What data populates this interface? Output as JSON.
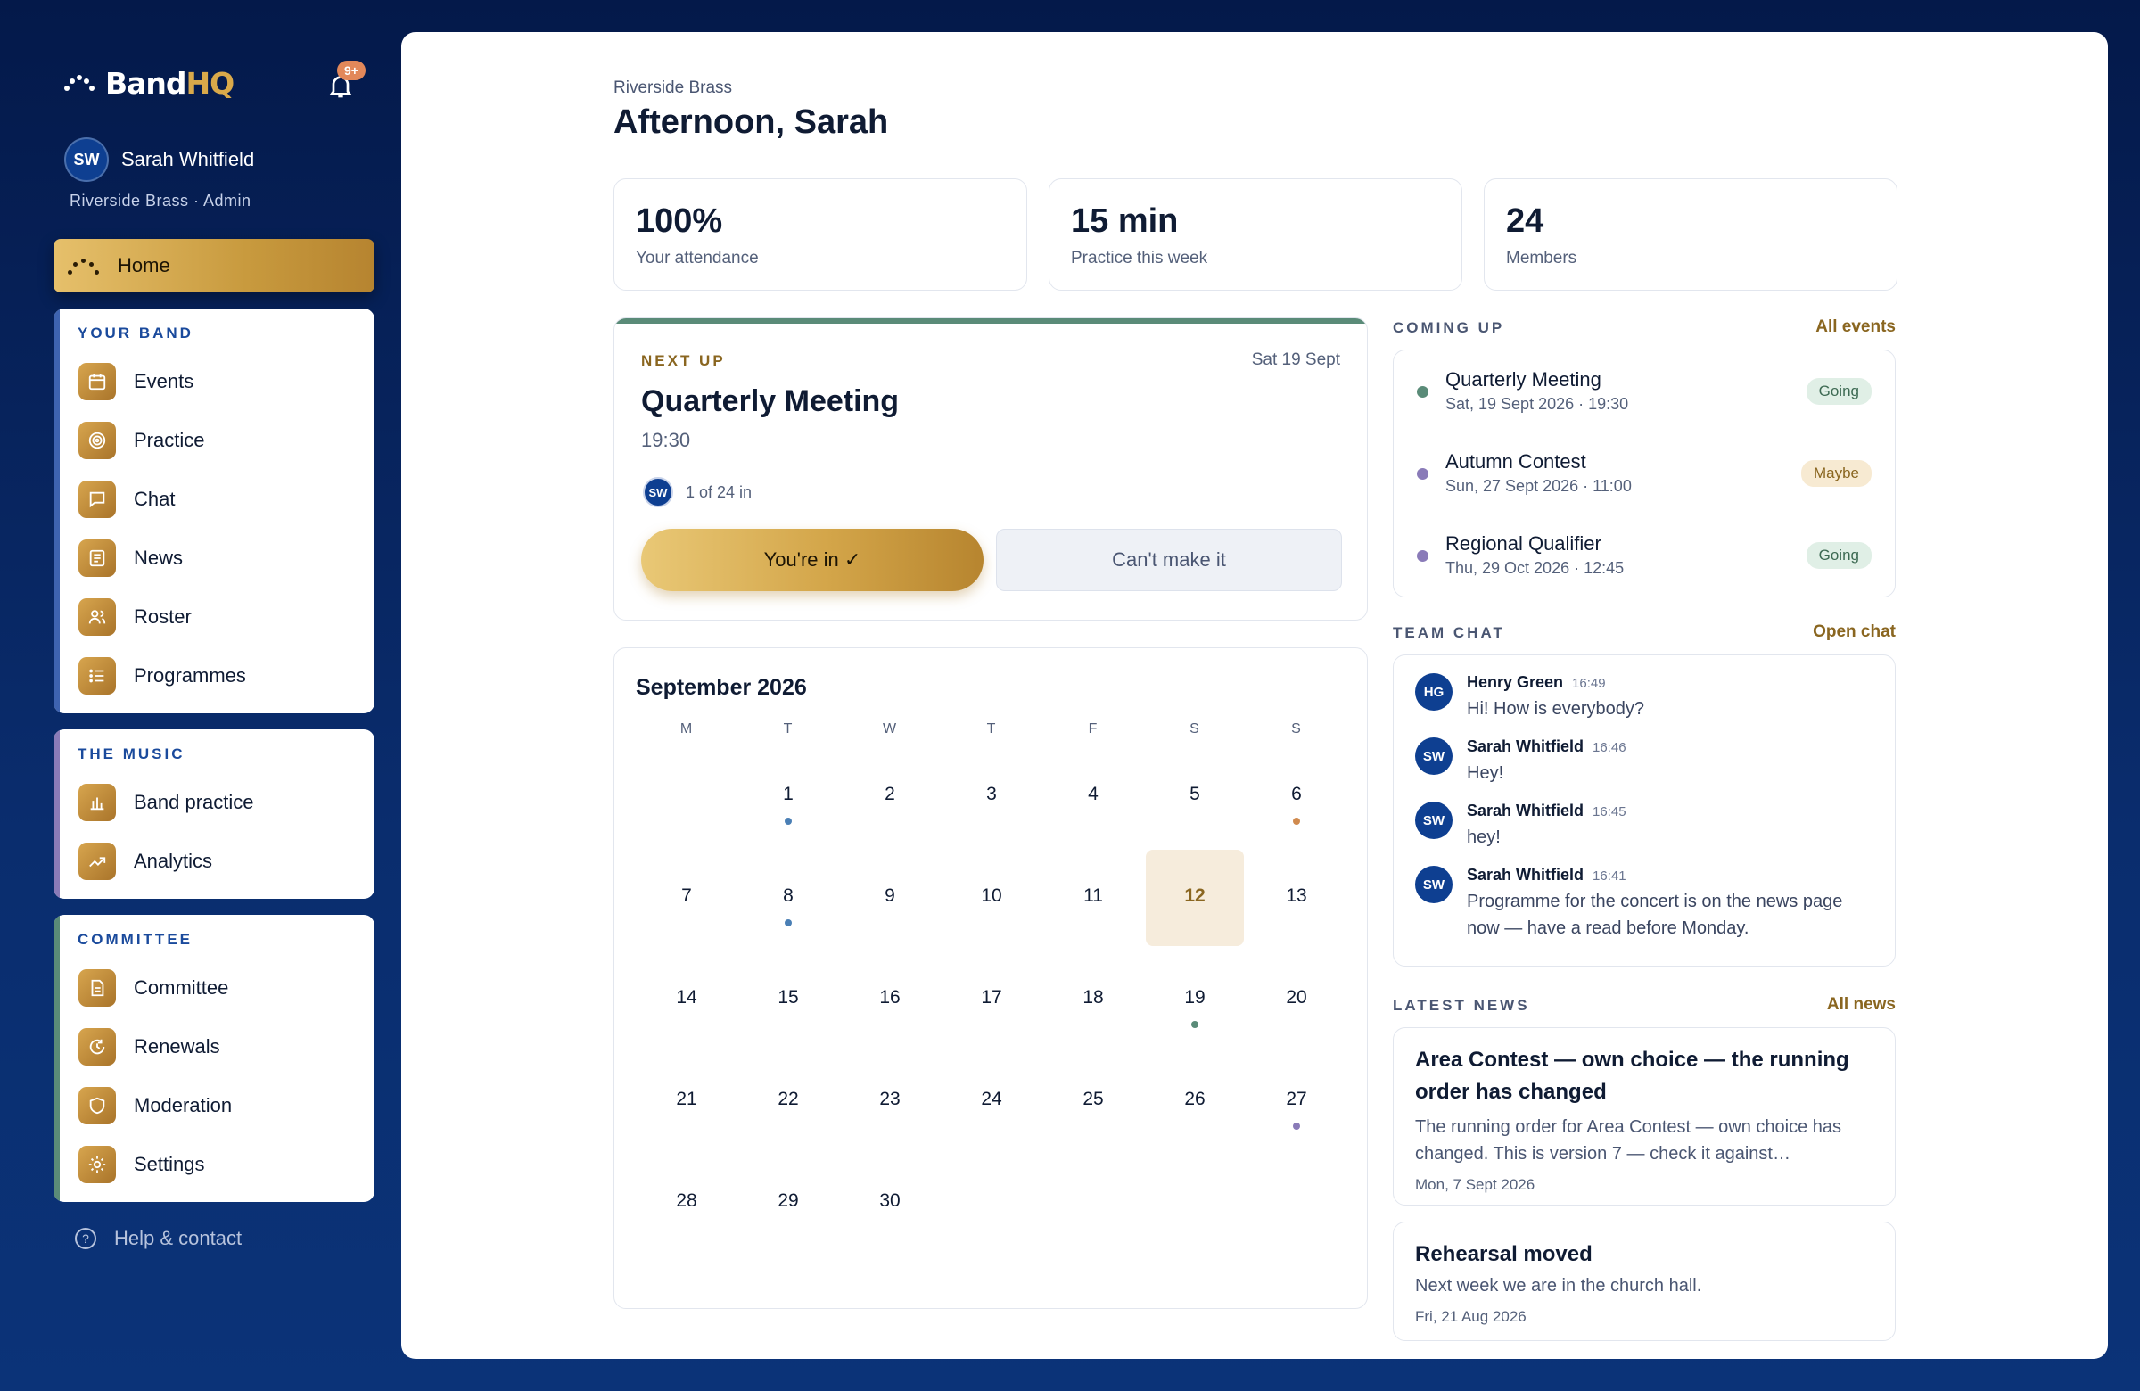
{
  "brand": {
    "name_part1": "Band",
    "name_part2": "HQ"
  },
  "notifications": {
    "badge": "9+"
  },
  "user": {
    "initials": "SW",
    "name": "Sarah Whitfield",
    "role": "Riverside Brass · Admin"
  },
  "nav": {
    "home": "Home",
    "groups": [
      {
        "title": "YOUR BAND",
        "items": [
          "Events",
          "Practice",
          "Chat",
          "News",
          "Roster",
          "Programmes"
        ]
      },
      {
        "title": "THE MUSIC",
        "items": [
          "Band practice",
          "Analytics"
        ]
      },
      {
        "title": "COMMITTEE",
        "items": [
          "Committee",
          "Renewals",
          "Moderation",
          "Settings"
        ]
      }
    ],
    "help": "Help & contact"
  },
  "header": {
    "breadcrumb": "Riverside Brass",
    "title": "Afternoon, Sarah"
  },
  "stats": [
    {
      "value": "100%",
      "label": "Your attendance"
    },
    {
      "value": "15 min",
      "label": "Practice this week"
    },
    {
      "value": "24",
      "label": "Members"
    }
  ],
  "next_up": {
    "kicker": "NEXT UP",
    "date": "Sat 19 Sept",
    "event": "Quarterly Meeting",
    "time": "19:30",
    "attendee_initials": "SW",
    "attendance": "1 of 24 in",
    "accept_label": "You're in ✓",
    "decline_label": "Can't make it"
  },
  "calendar": {
    "month": "September 2026",
    "weekdays": [
      "M",
      "T",
      "W",
      "T",
      "F",
      "S",
      "S"
    ],
    "days": [
      {
        "d": "1",
        "dot": "#4a7fb5"
      },
      {
        "d": "2"
      },
      {
        "d": "3"
      },
      {
        "d": "4"
      },
      {
        "d": "5"
      },
      {
        "d": "6",
        "dot": "#d08a4e"
      },
      {
        "d": "7"
      },
      {
        "d": "8",
        "dot": "#4a7fb5"
      },
      {
        "d": "9"
      },
      {
        "d": "10"
      },
      {
        "d": "11"
      },
      {
        "d": "12",
        "today": true
      },
      {
        "d": "13"
      },
      {
        "d": "14"
      },
      {
        "d": "15"
      },
      {
        "d": "16"
      },
      {
        "d": "17"
      },
      {
        "d": "18"
      },
      {
        "d": "19",
        "dot": "#5a8b78"
      },
      {
        "d": "20"
      },
      {
        "d": "21"
      },
      {
        "d": "22"
      },
      {
        "d": "23"
      },
      {
        "d": "24"
      },
      {
        "d": "25"
      },
      {
        "d": "26"
      },
      {
        "d": "27",
        "dot": "#8a7bb8"
      },
      {
        "d": "28"
      },
      {
        "d": "29"
      },
      {
        "d": "30"
      }
    ]
  },
  "coming_up": {
    "heading": "COMING UP",
    "link": "All events",
    "items": [
      {
        "title": "Quarterly Meeting",
        "when": "Sat, 19 Sept 2026 · 19:30",
        "status": "Going",
        "color": "#5a8b78"
      },
      {
        "title": "Autumn Contest",
        "when": "Sun, 27 Sept 2026 · 11:00",
        "status": "Maybe",
        "color": "#8a7bb8"
      },
      {
        "title": "Regional Qualifier",
        "when": "Thu, 29 Oct 2026 · 12:45",
        "status": "Going",
        "color": "#8a7bb8"
      }
    ]
  },
  "team_chat": {
    "heading": "TEAM CHAT",
    "link": "Open chat",
    "messages": [
      {
        "initials": "HG",
        "name": "Henry Green",
        "time": "16:49",
        "text": "Hi! How is everybody?"
      },
      {
        "initials": "SW",
        "name": "Sarah Whitfield",
        "time": "16:46",
        "text": "Hey!"
      },
      {
        "initials": "SW",
        "name": "Sarah Whitfield",
        "time": "16:45",
        "text": "hey!"
      },
      {
        "initials": "SW",
        "name": "Sarah Whitfield",
        "time": "16:41",
        "text": "Programme for the concert is on the news page now — have a read before Monday."
      }
    ]
  },
  "latest_news": {
    "heading": "LATEST NEWS",
    "link": "All news",
    "items": [
      {
        "title": "Area Contest — own choice — the running order has changed",
        "body": "The running order for Area Contest — own choice has changed. This is version 7 — check it against…",
        "date": "Mon, 7 Sept 2026"
      },
      {
        "title": "Rehearsal moved",
        "body": "Next week we are in the church hall.",
        "date": "Fri, 21 Aug 2026"
      }
    ]
  },
  "colors": {
    "accent_gold": "#c89a3e",
    "navy": "#0a2d6e",
    "group_bar_band": "#3e63b0",
    "group_bar_music": "#8a7bb8",
    "group_bar_committee": "#5a8b78"
  }
}
